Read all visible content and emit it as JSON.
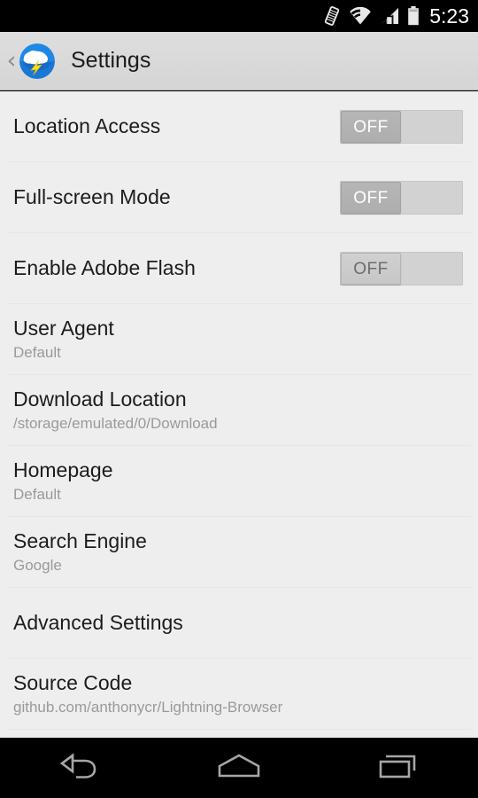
{
  "status_bar": {
    "time": "5:23",
    "icons": [
      "vibrate-icon",
      "wifi-icon",
      "cellular-signal-icon",
      "battery-icon"
    ]
  },
  "action_bar": {
    "back_label": "‹",
    "app_icon": "lightning-browser-icon",
    "title": "Settings"
  },
  "settings": {
    "items": [
      {
        "title": "Location Access",
        "sub": "",
        "type": "switch",
        "switch_value": "OFF",
        "switch_state": "off"
      },
      {
        "title": "Full-screen Mode",
        "sub": "",
        "type": "switch",
        "switch_value": "OFF",
        "switch_state": "off"
      },
      {
        "title": "Enable Adobe Flash",
        "sub": "",
        "type": "switch",
        "switch_value": "OFF",
        "switch_state": "disabled"
      },
      {
        "title": "User Agent",
        "sub": "Default",
        "type": "text"
      },
      {
        "title": "Download Location",
        "sub": "/storage/emulated/0/Download",
        "type": "text"
      },
      {
        "title": "Homepage",
        "sub": "Default",
        "type": "text"
      },
      {
        "title": "Search Engine",
        "sub": "Google",
        "type": "text"
      },
      {
        "title": "Advanced Settings",
        "sub": "",
        "type": "text"
      },
      {
        "title": "Source Code",
        "sub": "github.com/anthonycr/Lightning-Browser",
        "type": "text"
      }
    ]
  },
  "nav_bar": {
    "buttons": [
      {
        "name": "back-button",
        "icon": "back-arrow-icon"
      },
      {
        "name": "home-button",
        "icon": "home-icon"
      },
      {
        "name": "recents-button",
        "icon": "recents-icon"
      }
    ]
  },
  "colors": {
    "status_bar_bg": "#000000",
    "action_bar_bg": "#d9d9d9",
    "list_bg": "#eeeeee",
    "title_text": "#1c1c1c",
    "sub_text": "#9a9a9a",
    "divider": "#dcdcdc",
    "icon_blue": "#1e88e5",
    "icon_yellow": "#ffdd00",
    "nav_bar_bg": "#000000"
  }
}
